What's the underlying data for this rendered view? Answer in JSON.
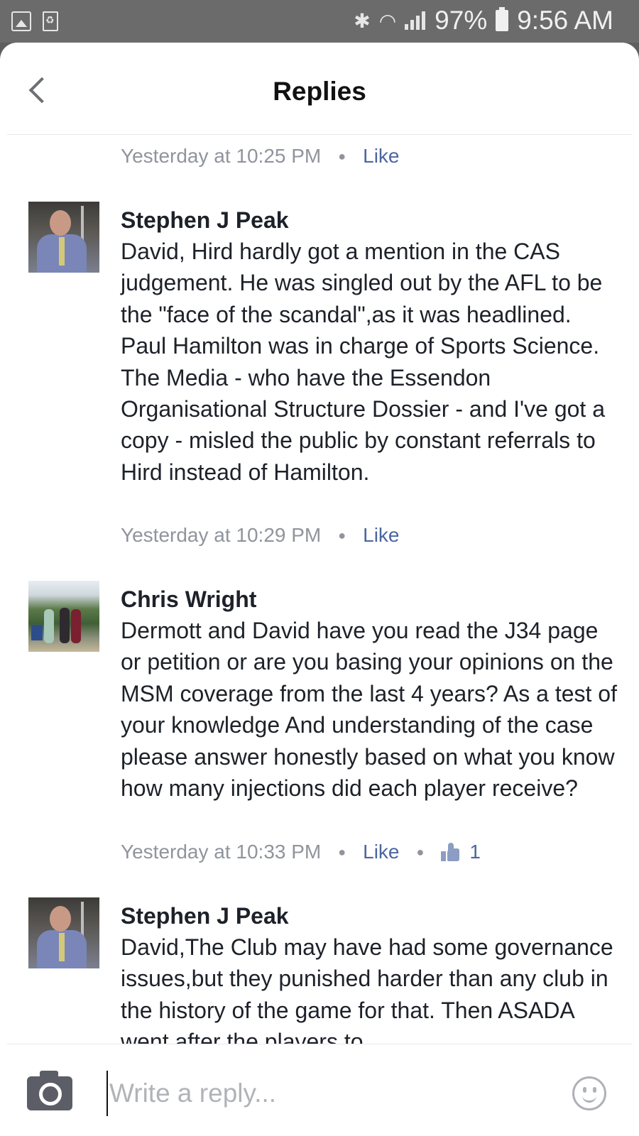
{
  "status_bar": {
    "battery": "97%",
    "time": "9:56 AM",
    "icons": [
      "gallery-icon",
      "recycle-icon",
      "bluetooth-icon",
      "wifi-icon",
      "signal-icon",
      "battery-icon"
    ]
  },
  "header": {
    "title": "Replies"
  },
  "feed": {
    "top_meta": {
      "timestamp": "Yesterday at 10:25 PM",
      "like_label": "Like"
    },
    "comments": [
      {
        "author": "Stephen J Peak",
        "text": "David, Hird hardly got a mention in the CAS judgement. He was singled out by the AFL to be the \"face of the scandal\",as it was headlined. Paul Hamilton was in charge of Sports Science. The Media - who have the Essendon Organisational Structure Dossier - and I've got a copy - misled the public by constant referrals to Hird instead of Hamilton.",
        "timestamp": "Yesterday at 10:29 PM",
        "like_label": "Like"
      },
      {
        "author": "Chris Wright",
        "text": "Dermott and David have you read the J34 page or petition or are you basing your opinions on the MSM coverage from the last 4 years? As a test of your knowledge And understanding of the case please answer honestly based on what you know how many injections did each player receive?",
        "timestamp": "Yesterday at 10:33 PM",
        "like_label": "Like",
        "reaction_count": "1"
      },
      {
        "author": "Stephen J Peak",
        "text": "David,The Club may have had some governance issues,but they punished harder than any club in the history of the game for that. Then ASADA went after the players to"
      }
    ]
  },
  "composer": {
    "placeholder": "Write a reply..."
  },
  "colors": {
    "link": "#4b67a1",
    "meta": "#90949c",
    "text": "#1d2129"
  }
}
